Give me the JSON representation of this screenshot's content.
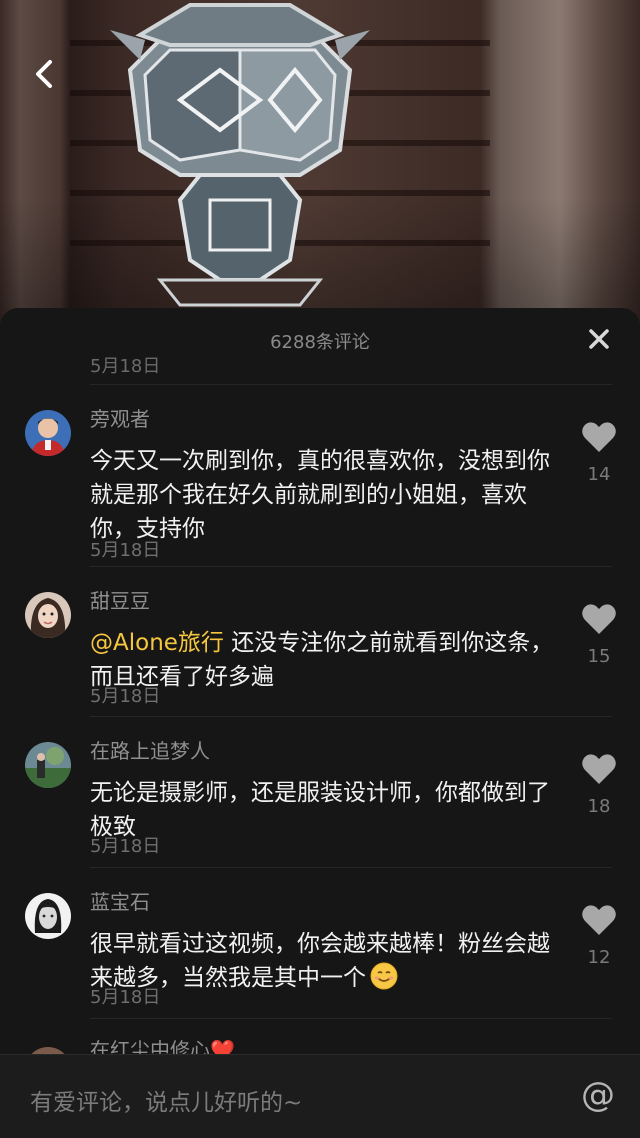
{
  "panel": {
    "title": "6288条评论"
  },
  "partial_top_date": "5月18日",
  "comments": [
    {
      "author": "旁观者",
      "text": "今天又一次刷到你，真的很喜欢你，没想到你就是那个我在好久前就刷到的小姐姐，喜欢你，支持你",
      "date": "5月18日",
      "likes": "14",
      "avatar_icon": "avatar-man-red-suit"
    },
    {
      "author": "甜豆豆",
      "mention": "@Alone旅行",
      "text": " 还没专注你之前就看到你这条，而且还看了好多遍",
      "date": "5月18日",
      "likes": "15",
      "avatar_icon": "avatar-girl"
    },
    {
      "author": "在路上追梦人",
      "text": "无论是摄影师，还是服装设计师，你都做到了极致",
      "date": "5月18日",
      "likes": "18",
      "avatar_icon": "avatar-landscape"
    },
    {
      "author": "蓝宝石",
      "text": "很早就看过这视频，你会越来越棒！粉丝会越来越多，当然我是其中一个",
      "emoji": "smiling-face-emoji",
      "date": "5月18日",
      "likes": "12",
      "avatar_icon": "avatar-woman-bw"
    },
    {
      "author": "在红尘中修心❤️",
      "avatar_icon": "avatar-partial"
    }
  ],
  "input": {
    "placeholder": "有爱评论，说点儿好听的~",
    "at_symbol": "@"
  },
  "colors": {
    "panel_bg": "#161616",
    "mention": "#f6c73e",
    "text": "#f1f1f1",
    "muted": "#8f8f8f"
  }
}
